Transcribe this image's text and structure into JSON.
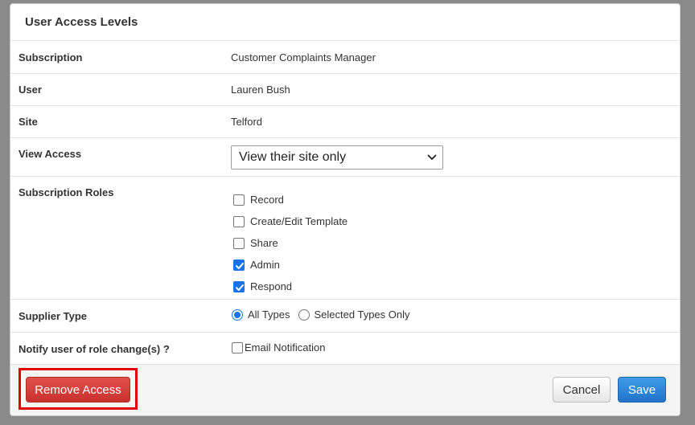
{
  "modal": {
    "title": "User Access Levels"
  },
  "fields": {
    "subscription": {
      "label": "Subscription",
      "value": "Customer Complaints Manager"
    },
    "user": {
      "label": "User",
      "value": "Lauren Bush"
    },
    "site": {
      "label": "Site",
      "value": "Telford"
    },
    "view_access": {
      "label": "View Access",
      "selected": "View their site only"
    },
    "subscription_roles": {
      "label": "Subscription Roles",
      "options": [
        {
          "label": "Record",
          "checked": false
        },
        {
          "label": "Create/Edit Template",
          "checked": false
        },
        {
          "label": "Share",
          "checked": false
        },
        {
          "label": "Admin",
          "checked": true
        },
        {
          "label": "Respond",
          "checked": true
        }
      ]
    },
    "supplier_type": {
      "label": "Supplier Type",
      "options": [
        {
          "label": "All Types",
          "selected": true
        },
        {
          "label": "Selected Types Only",
          "selected": false
        }
      ]
    },
    "notify": {
      "label": "Notify user of role change(s) ?",
      "option_label": "Email Notification",
      "checked": false
    }
  },
  "footer": {
    "remove_label": "Remove Access",
    "cancel_label": "Cancel",
    "save_label": "Save"
  },
  "colors": {
    "accent": "#1a73e8",
    "danger": "#c9302c",
    "primary": "#2173c9",
    "highlight_outline": "#e00000"
  }
}
